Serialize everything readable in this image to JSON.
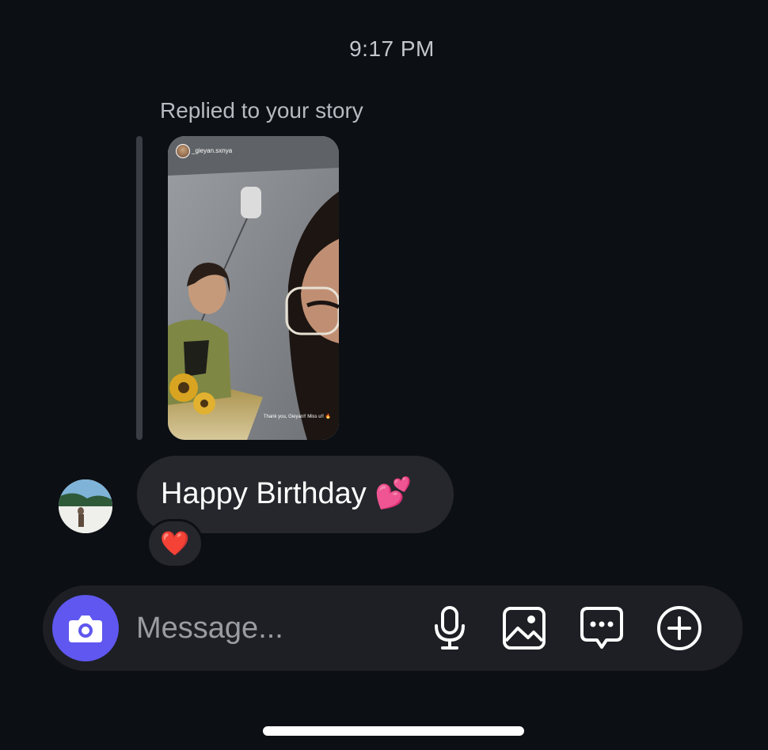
{
  "conversation": {
    "timestamp": "9:17 PM",
    "reply_label": "Replied to your story",
    "story": {
      "username": "_gieyan.sxnya",
      "caption": "Thank you, Gieyan!! Miss u!! 🔥"
    },
    "message": {
      "text": "Happy Birthday 💕",
      "reaction": "❤️"
    }
  },
  "composer": {
    "placeholder": "Message...",
    "icons": [
      "camera-icon",
      "microphone-icon",
      "gallery-icon",
      "sticker-icon",
      "add-icon"
    ]
  },
  "colors": {
    "background": "#0c0f14",
    "bubble": "#25272c",
    "composer": "#1d1f24",
    "accent": "#5f57ef"
  }
}
